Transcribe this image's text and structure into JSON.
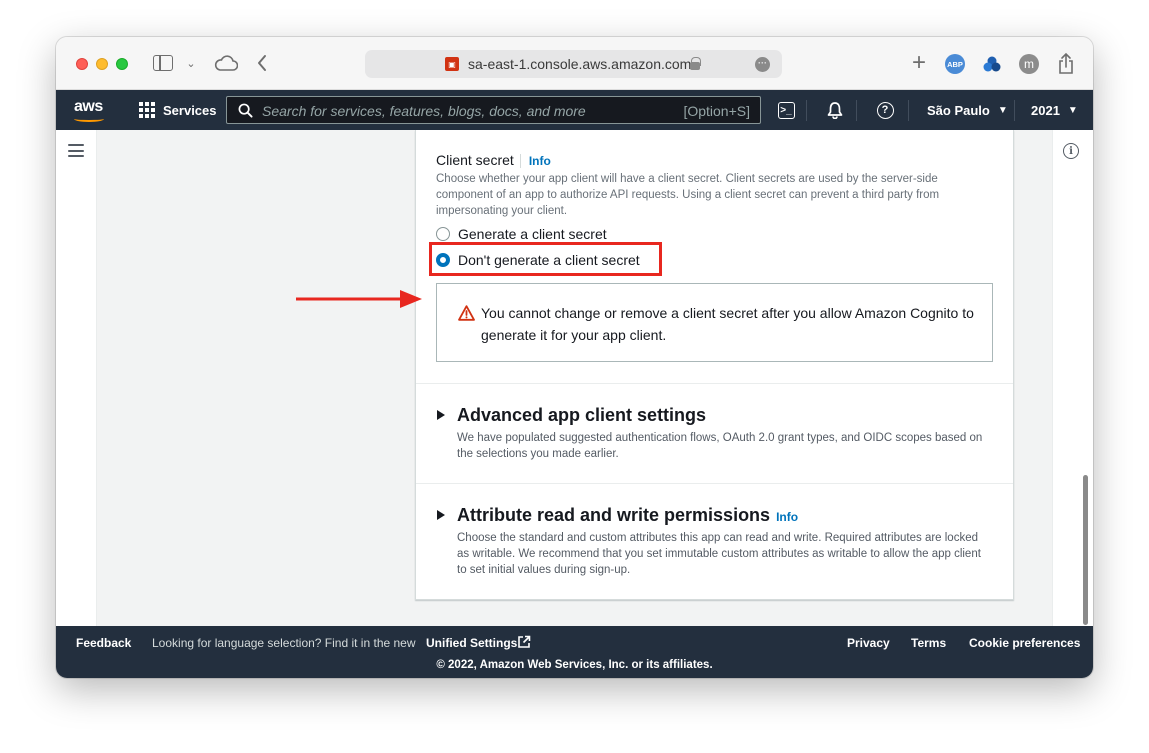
{
  "browser": {
    "url": "sa-east-1.console.aws.amazon.com",
    "abp_label": "ABP",
    "profile_initial": "m"
  },
  "nav": {
    "logo": "aws",
    "services_label": "Services",
    "search_placeholder": "Search for services, features, blogs, docs, and more",
    "search_shortcut": "[Option+S]",
    "region_label": "São Paulo",
    "account_label": "2021"
  },
  "client_secret": {
    "label": "Client secret",
    "info_label": "Info",
    "description": "Choose whether your app client will have a client secret. Client secrets are used by the server-side component of an app to authorize API requests. Using a client secret can prevent a third party from impersonating your client.",
    "options": [
      {
        "label": "Generate a client secret",
        "selected": false
      },
      {
        "label": "Don't generate a client secret",
        "selected": true
      }
    ],
    "warning": "You cannot change or remove a client secret after you allow Amazon Cognito to generate it for your app client."
  },
  "advanced_settings": {
    "title": "Advanced app client settings",
    "description": "We have populated suggested authentication flows, OAuth 2.0 grant types, and OIDC scopes based on the selections you made earlier."
  },
  "attribute_permissions": {
    "title": "Attribute read and write permissions",
    "info_label": "Info",
    "description": "Choose the standard and custom attributes this app can read and write. Required attributes are locked as writable. We recommend that you set immutable custom attributes as writable to allow the app client to set initial values during sign-up."
  },
  "footer": {
    "feedback": "Feedback",
    "language_prompt": "Looking for language selection? Find it in the new",
    "unified_settings": "Unified Settings",
    "privacy": "Privacy",
    "terms": "Terms",
    "cookie_preferences": "Cookie preferences",
    "copyright": "© 2022, Amazon Web Services, Inc. or its affiliates."
  },
  "colors": {
    "aws_nav_bg": "#232f3e",
    "aws_orange": "#ff9900",
    "link_blue": "#0073bb",
    "annotation_red": "#e8271f",
    "warning_red": "#d13212"
  },
  "icons": {
    "sidebar": "sidebar-toggle-icon",
    "cloud": "icloud-icon",
    "back": "chevron-left-icon",
    "lock": "lock-icon",
    "new_tab": "plus-icon",
    "share": "share-icon",
    "grid": "grid-icon",
    "search": "search-icon",
    "cloudshell": "cloudshell-icon",
    "bell": "bell-icon",
    "help": "help-icon",
    "menu": "hamburger-icon",
    "info": "info-icon",
    "warning": "warning-icon",
    "expand": "caret-right-icon",
    "external": "external-link-icon"
  }
}
